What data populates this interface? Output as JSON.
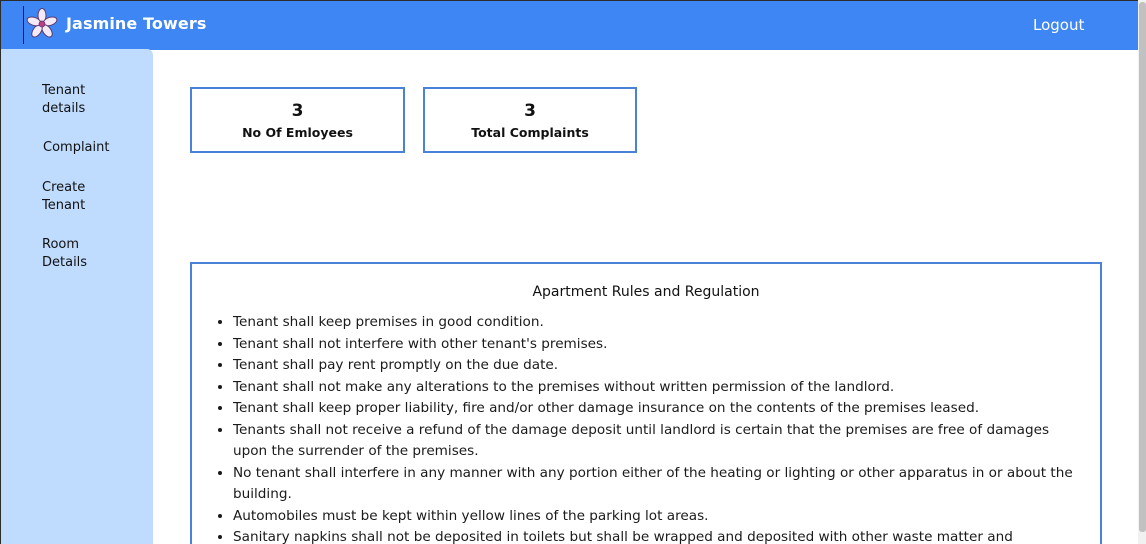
{
  "app": {
    "title": "Jasmine Towers",
    "logout_label": "Logout",
    "brand_color": "#3f86f5",
    "sidebar_color": "#bfdcff",
    "logo_icon": "jasmine-flower-icon"
  },
  "sidebar": {
    "items": [
      {
        "line1": "Tenant",
        "line2": "details"
      },
      {
        "line1": "Complaint",
        "line2": ""
      },
      {
        "line1": "Create",
        "line2": "Tenant"
      },
      {
        "line1": "Room",
        "line2": "Details"
      }
    ]
  },
  "stats": [
    {
      "value": "3",
      "label": "No Of Emloyees"
    },
    {
      "value": "3",
      "label": "Total Complaints"
    }
  ],
  "rules": {
    "title": "Apartment Rules and Regulation",
    "items": [
      "Tenant shall keep premises in good condition.",
      "Tenant shall not interfere with other tenant's premises.",
      "Tenant shall pay rent promptly on the due date.",
      "Tenant shall not make any alterations to the premises without written permission of the landlord.",
      "Tenant shall keep proper liability, fire and/or other damage insurance on the contents of the premises leased.",
      "Tenants shall not receive a refund of the damage deposit until landlord is certain that the premises are free of damages upon the surrender of the premises.",
      "No tenant shall interfere in any manner with any portion either of the heating or lighting or other apparatus in or about the building.",
      "Automobiles must be kept within yellow lines of the parking lot areas.",
      "Sanitary napkins shall not be deposited in toilets but shall be wrapped and deposited with other waste matter and"
    ]
  }
}
